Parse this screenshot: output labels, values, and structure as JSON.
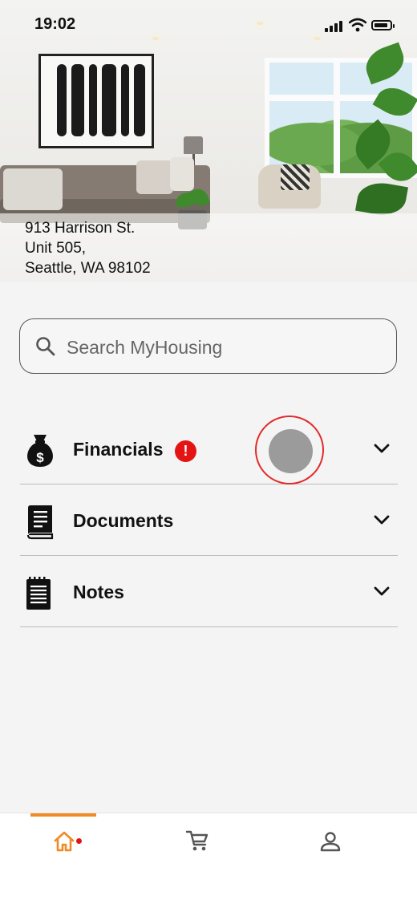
{
  "status_bar": {
    "time": "19:02"
  },
  "property": {
    "address_line1": "913 Harrison St.",
    "address_line2": "Unit 505,",
    "address_line3": "Seattle, WA 98102"
  },
  "search": {
    "placeholder": "Search MyHousing",
    "value": ""
  },
  "sections": [
    {
      "label": "Financials",
      "icon": "money-bag-icon",
      "alert": "!"
    },
    {
      "label": "Documents",
      "icon": "book-icon"
    },
    {
      "label": "Notes",
      "icon": "notepad-icon"
    }
  ],
  "bottom_nav": {
    "items": [
      {
        "icon": "home-icon",
        "active": true,
        "notification_dot": true
      },
      {
        "icon": "cart-icon",
        "active": false
      },
      {
        "icon": "person-icon",
        "active": false
      }
    ]
  },
  "colors": {
    "accent": "#f08a24",
    "alert": "#e41414",
    "tap_ring": "#e12b2b"
  }
}
